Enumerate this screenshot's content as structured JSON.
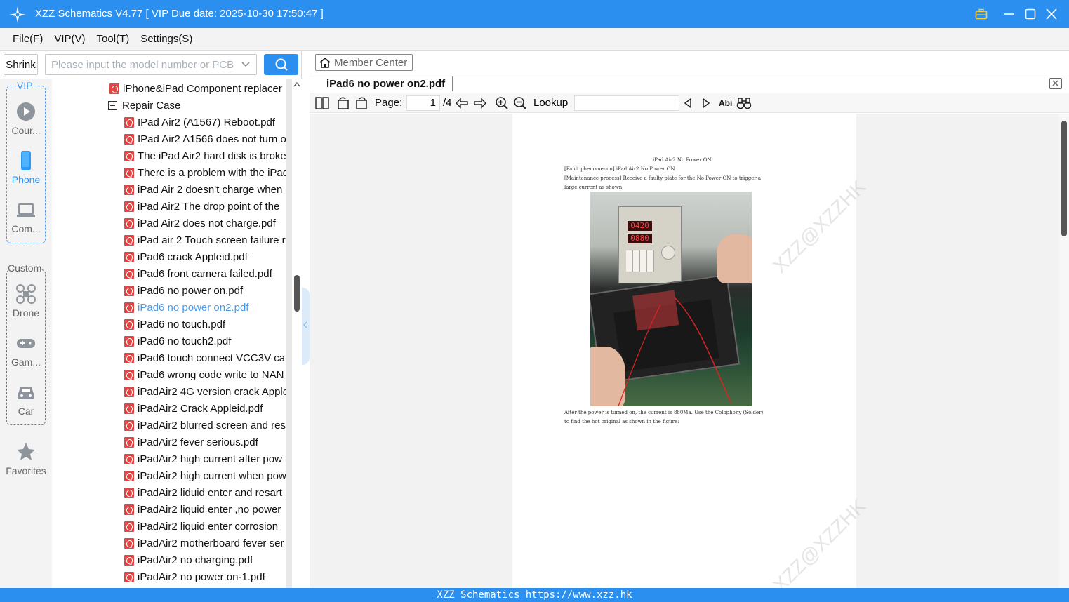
{
  "app": {
    "title": "XZZ Schematics V4.77 [ VIP Due date: 2025-10-30 17:50:47 ]"
  },
  "menu": [
    "File(F)",
    "VIP(V)",
    "Tool(T)",
    "Settings(S)"
  ],
  "search": {
    "shrink_label": "Shrink",
    "placeholder": "Please input the model number or PCB"
  },
  "categories": {
    "vip_label": "VIP",
    "custom_label": "Custom",
    "items": [
      {
        "label": "Cour...",
        "icon": "play-icon",
        "active": false
      },
      {
        "label": "Phone",
        "icon": "phone-icon",
        "active": true
      },
      {
        "label": "Com...",
        "icon": "laptop-icon",
        "active": false
      },
      {
        "label": "Drone",
        "icon": "drone-icon",
        "active": false
      },
      {
        "label": "Gam...",
        "icon": "gamepad-icon",
        "active": false
      },
      {
        "label": "Car",
        "icon": "car-icon",
        "active": false
      },
      {
        "label": "Favorites",
        "icon": "star-icon",
        "active": false
      }
    ]
  },
  "tree": {
    "top_item": "iPhone&iPad Component replacer",
    "folder": "Repair Case",
    "files": [
      "IPad Air2 (A1567) Reboot.pdf",
      "IPad Air2 A1566 does not turn o",
      "The iPad Air2 hard disk is broke",
      "There is a problem with the iPad",
      "iPad Air 2 doesn't charge when",
      "iPad Air2 The drop point of the",
      "iPad Air2 does not charge.pdf",
      "iPad air 2 Touch screen failure r",
      "iPad6 crack Appleid.pdf",
      "iPad6 front camera failed.pdf",
      "iPad6 no power on.pdf",
      "iPad6 no power on2.pdf",
      "iPad6 no touch.pdf",
      "iPad6 no touch2.pdf",
      "iPad6 touch connect VCC3V cap",
      "iPad6 wrong code write to NAN",
      "iPadAir2 4G version crack Apple",
      "iPadAir2 Crack Appleid.pdf",
      "iPadAir2 blurred screen and res",
      "iPadAir2 fever serious.pdf",
      "iPadAir2 high current after pow",
      "iPadAir2 high current when pow",
      "iPadAir2 liduid enter and resart",
      "iPadAir2 liquid enter ,no power",
      "iPadAir2 liquid enter corrosion",
      "iPadAir2 motherboard fever ser",
      "iPadAir2 no charging.pdf",
      "iPadAir2 no power on-1.pdf"
    ],
    "selected_file": "iPad6 no power on2.pdf"
  },
  "viewer": {
    "member_center": "Member Center",
    "tab": "iPad6 no power on2.pdf",
    "page_label": "Page:",
    "page_current": "1",
    "page_total": "/4",
    "lookup_label": "Lookup",
    "abi_label": "Abi"
  },
  "document": {
    "heading": "iPad Air2 No Power ON",
    "line1": "[Fault phenomenon] iPad Air2 No Power ON",
    "line2": "[Maintenance process] Receive a faulty plate for the No Power ON to trigger a",
    "line3": "large current as shown:",
    "display_voltage": "0420",
    "display_current": "0880",
    "line4": "After the power is turned on, the current is 880Ma. Use the Colophony (Solder)",
    "line5": "to find the hot original as shown in the figure:",
    "watermark": "XZZ@XZZHK"
  },
  "statusbar": "XZZ Schematics https://www.xzz.hk"
}
